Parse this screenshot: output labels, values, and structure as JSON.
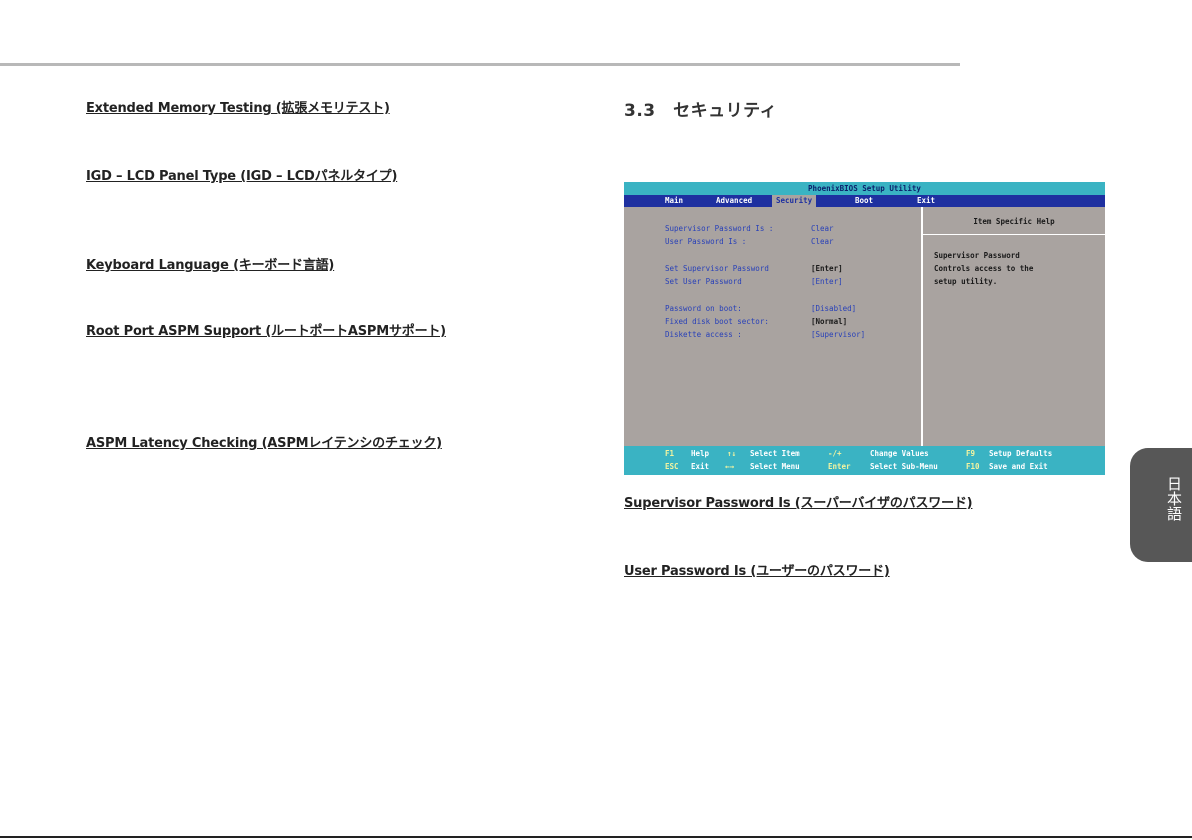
{
  "left_headings": [
    "Extended Memory Testing (拡張メモリテスト)",
    "IGD – LCD Panel Type (IGD – LCDパネルタイプ)",
    "Keyboard Language (キーボード言語)",
    "Root Port ASPM Support (ルートポートASPMサポート)",
    "ASPM Latency Checking (ASPMレイテンシのチェック)"
  ],
  "section_title": "3.3　セキュリティ",
  "bios": {
    "title": "PhoenixBIOS Setup Utility",
    "menu": [
      "Main",
      "Advanced",
      "Security",
      "Boot",
      "Exit"
    ],
    "active_menu": "Security",
    "rows": [
      {
        "label": "Supervisor Password Is :",
        "value": "Clear"
      },
      {
        "label": "User Password Is :",
        "value": "Clear"
      },
      {
        "label": "Set Supervisor Password",
        "value": "[Enter]"
      },
      {
        "label": "Set User Password",
        "value": "[Enter]"
      },
      {
        "label": "Password on boot:",
        "value": "[Disabled]"
      },
      {
        "label": "Fixed disk boot sector:",
        "value": "[Normal]"
      },
      {
        "label": "Diskette access :",
        "value": "[Supervisor]"
      }
    ],
    "help_title": "Item Specific Help",
    "help_lines": [
      "Supervisor Password",
      "Controls access to the",
      "setup utility."
    ],
    "footer": {
      "row1": [
        {
          "key": "F1",
          "text": "Help"
        },
        {
          "key": "↑↓",
          "text": "Select Item"
        },
        {
          "key": "-/+",
          "text": "Change Values"
        },
        {
          "key": "F9",
          "text": "Setup Defaults"
        }
      ],
      "row2": [
        {
          "key": "ESC",
          "text": "Exit"
        },
        {
          "key": "←→",
          "text": "Select Menu"
        },
        {
          "key": "Enter",
          "text": "Select Sub-Menu"
        },
        {
          "key": "F10",
          "text": "Save and Exit"
        }
      ]
    }
  },
  "right_headings": [
    "Supervisor Password Is (スーパーバイザのパスワード)",
    "User Password Is (ユーザーのパスワード)"
  ],
  "side_tab": "日本語",
  "colors": {
    "bios_cyan": "#3ab3c3",
    "bios_blue": "#1e30a0",
    "bios_gray": "#a9a3a0",
    "tab_gray": "#575757"
  }
}
